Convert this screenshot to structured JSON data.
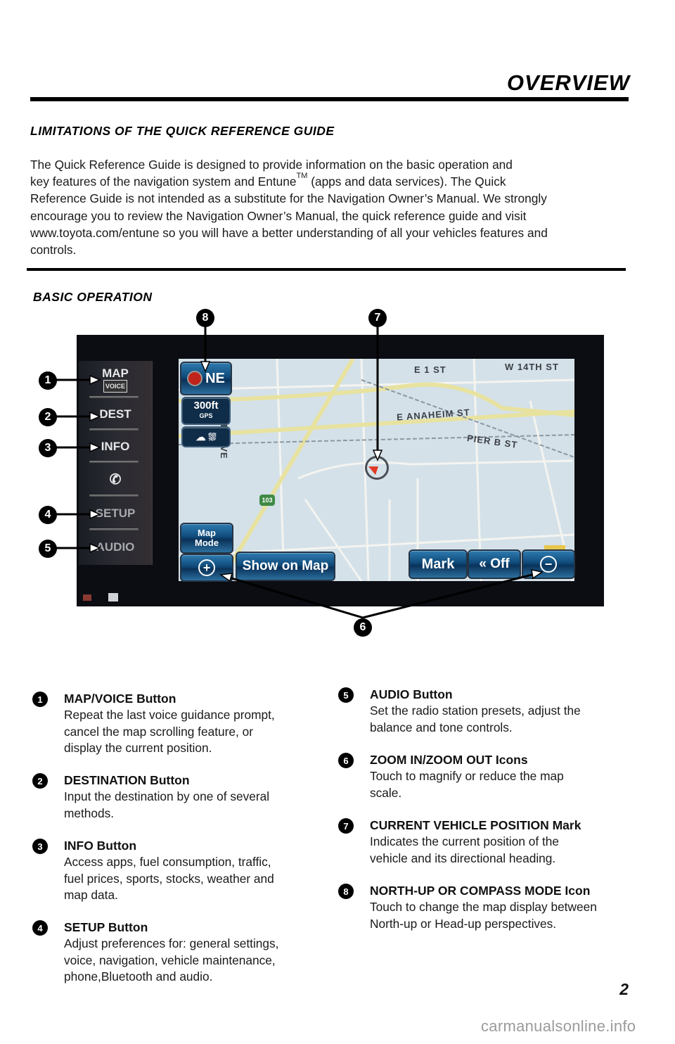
{
  "header": {
    "section": "OVERVIEW",
    "page_number": "2"
  },
  "limitations": {
    "title": "LIMITATIONS OF THE QUICK REFERENCE GUIDE",
    "lines": [
      "The Quick Reference Guide is designed to provide information on the basic operation and",
      "key features of the navigation system and Entune",
      "(apps and data services). The Quick",
      "Reference Guide is not intended as a substitute for the Navigation Owner’s Manual. We strongly",
      "encourage you to review the Navigation Owner’s Manual, the quick reference guide and visit",
      "www.toyota.com/entune so you will have a better understanding of all your vehicles features and",
      "controls."
    ],
    "trademark": "TM"
  },
  "basic_operation": {
    "title": "BASIC OPERATION",
    "screen": {
      "sidebar": {
        "map": "MAP",
        "voice": "VOICE",
        "dest": "DEST",
        "info": "INFO",
        "phone_icon": "✆",
        "setup": "SETUP",
        "audio": "AUDIO"
      },
      "map_labels": {
        "street_1": "E 1 ST",
        "street_2": "W 14TH ST",
        "street_3": "E ANAHEIM ST",
        "street_4": "PIER B ST",
        "street_5": "FOOTE AVE",
        "route_shield": "103"
      },
      "compass_heading": "NE",
      "scale": "300ft",
      "gps": "GPS",
      "buttons": {
        "map_mode_1": "Map",
        "map_mode_2": "Mode",
        "zoom_in": "+",
        "show_on_map": "Show on Map",
        "mark": "Mark",
        "off": "« Off",
        "zoom_out": "−"
      }
    },
    "callouts": [
      "1",
      "2",
      "3",
      "4",
      "5",
      "6",
      "7",
      "8"
    ]
  },
  "items": [
    {
      "num": "1",
      "title": "MAP/VOICE Button",
      "lines": [
        "Repeat the last voice guidance prompt,",
        "cancel the map scrolling feature, or",
        "display the current position."
      ]
    },
    {
      "num": "2",
      "title": "DESTINATION Button",
      "lines": [
        "Input the destination by one of several",
        "methods."
      ]
    },
    {
      "num": "3",
      "title": "INFO Button",
      "lines": [
        "Access apps, fuel consumption, traffic,",
        "fuel prices, sports, stocks, weather and",
        "map data."
      ]
    },
    {
      "num": "4",
      "title": "SETUP Button",
      "lines": [
        "Adjust preferences for: general settings,",
        "voice, navigation, vehicle maintenance,",
        "phone,Bluetooth and audio."
      ]
    },
    {
      "num": "5",
      "title": "AUDIO Button",
      "lines": [
        "Set the radio station presets, adjust the",
        "balance and tone controls."
      ]
    },
    {
      "num": "6",
      "title": "ZOOM IN/ZOOM OUT Icons",
      "lines": [
        "Touch to magnify or reduce the map",
        "scale."
      ]
    },
    {
      "num": "7",
      "title": "CURRENT VEHICLE POSITION Mark",
      "lines": [
        "Indicates the current position of the",
        "vehicle and its directional heading."
      ]
    },
    {
      "num": "8",
      "title": "NORTH-UP OR COMPASS MODE Icon",
      "lines": [
        "Touch to change the map display between",
        "North-up or Head-up perspectives."
      ]
    }
  ],
  "watermark": "carmanualsonline.info"
}
